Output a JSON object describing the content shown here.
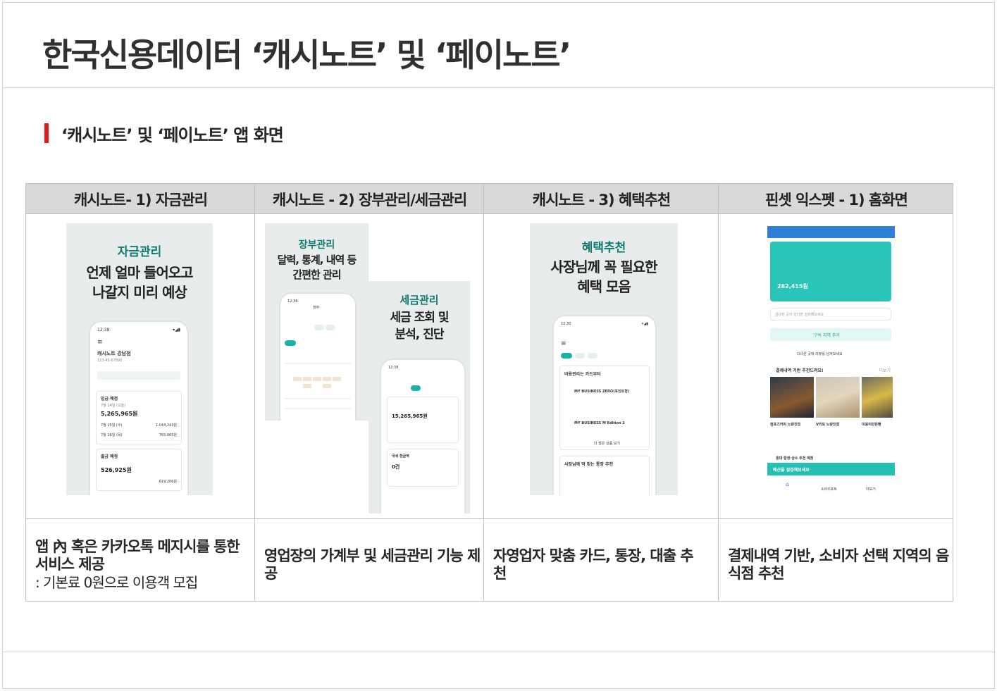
{
  "title": "한국신용데이터 ‘캐시노트’ 및 ‘페이노트’",
  "section_title": "‘캐시노트’ 및 ‘페이노트’ 앱 화면",
  "table": {
    "headers": [
      "캐시노트- 1) 자금관리",
      "캐시노트 - 2) 장부관리/세금관리",
      "캐시노트 - 3) 혜택추천",
      "핀셋 익스펫 - 1) 홈화면"
    ],
    "descriptions": [
      {
        "main": "앱 內 혹은 카카오톡 메지시를 통한 서비스 제공",
        "sub": ": 기본료 0원으로 이용객 모집"
      },
      {
        "main": "영업장의 가계부 및 세금관리 기능 제공",
        "sub": ""
      },
      {
        "main": "자영업자 맞춤 카드, 통장, 대출 추천",
        "sub": ""
      },
      {
        "main": "결제내역 기반, 소비자 선택 지역의 음식점 추천",
        "sub": ""
      }
    ]
  },
  "shots": {
    "fund": {
      "label": "자금관리",
      "headline1": "언제 얼마 들어오고",
      "headline2": "나갈지 미리 예상",
      "time": "12:38",
      "store": "캐시노트 강남점",
      "store_no": "123-45-67890",
      "in_label": "입금 예정",
      "in_date": "7월 14일 (오늘)",
      "in_amount": "5,265,965원",
      "row1_date": "7월 15일 (수)",
      "row1_amt": "1,044,243원",
      "row2_date": "7월 16일 (목)",
      "row2_amt": "765,065원",
      "out_label": "출금 예정",
      "out_amount": "526,925원",
      "out_amt2": "619,206원"
    },
    "ledger": {
      "label": "장부관리",
      "headline1": "달력, 통계, 내역 등",
      "headline2": "간편한 관리",
      "time": "12:38",
      "tab": "장부"
    },
    "tax": {
      "label": "세금관리",
      "headline1": "세금 조회 및",
      "headline2": "분석, 진단",
      "time": "12:38",
      "amount": "15,265,965원",
      "refund_label": "국세 환급액",
      "refund_value": "0건"
    },
    "benefit": {
      "label": "혜택추천",
      "headline1": "사장님께 꼭 필요한",
      "headline2": "혜택 모음",
      "time": "12:30",
      "card_title": "비용관리는 카드부터",
      "card1": "MY BUSINESS ZERO(포인트형)",
      "card2": "MY BUSINESS M Edition 2",
      "more": "더 많은 상품 보기",
      "account_title": "사장님께 딱 맞는 통장 추천"
    },
    "finset": {
      "balance": "282,415원",
      "search": "궁금한 곳이 있다면 검색해보세요",
      "add_region": "구독 지역 추가",
      "review": "다녀온 곳에 리뷰를 남겨보세요",
      "rec_title": "결제내역 기반 추천드려요!",
      "more": "더보기",
      "places": [
        "컴포즈커피 노량진점",
        "V리또 노량진점",
        "이웅이만든빵"
      ],
      "banner": "예산을 설정해보세요",
      "region_title": "홍대·합정·상수 추천 예정",
      "nav_report": "소비리포트",
      "nav_more": "더보기"
    }
  },
  "colors": {
    "accent_red": "#e21b1b",
    "teal": "#17a89a",
    "header_gray": "#d9d9d9"
  }
}
